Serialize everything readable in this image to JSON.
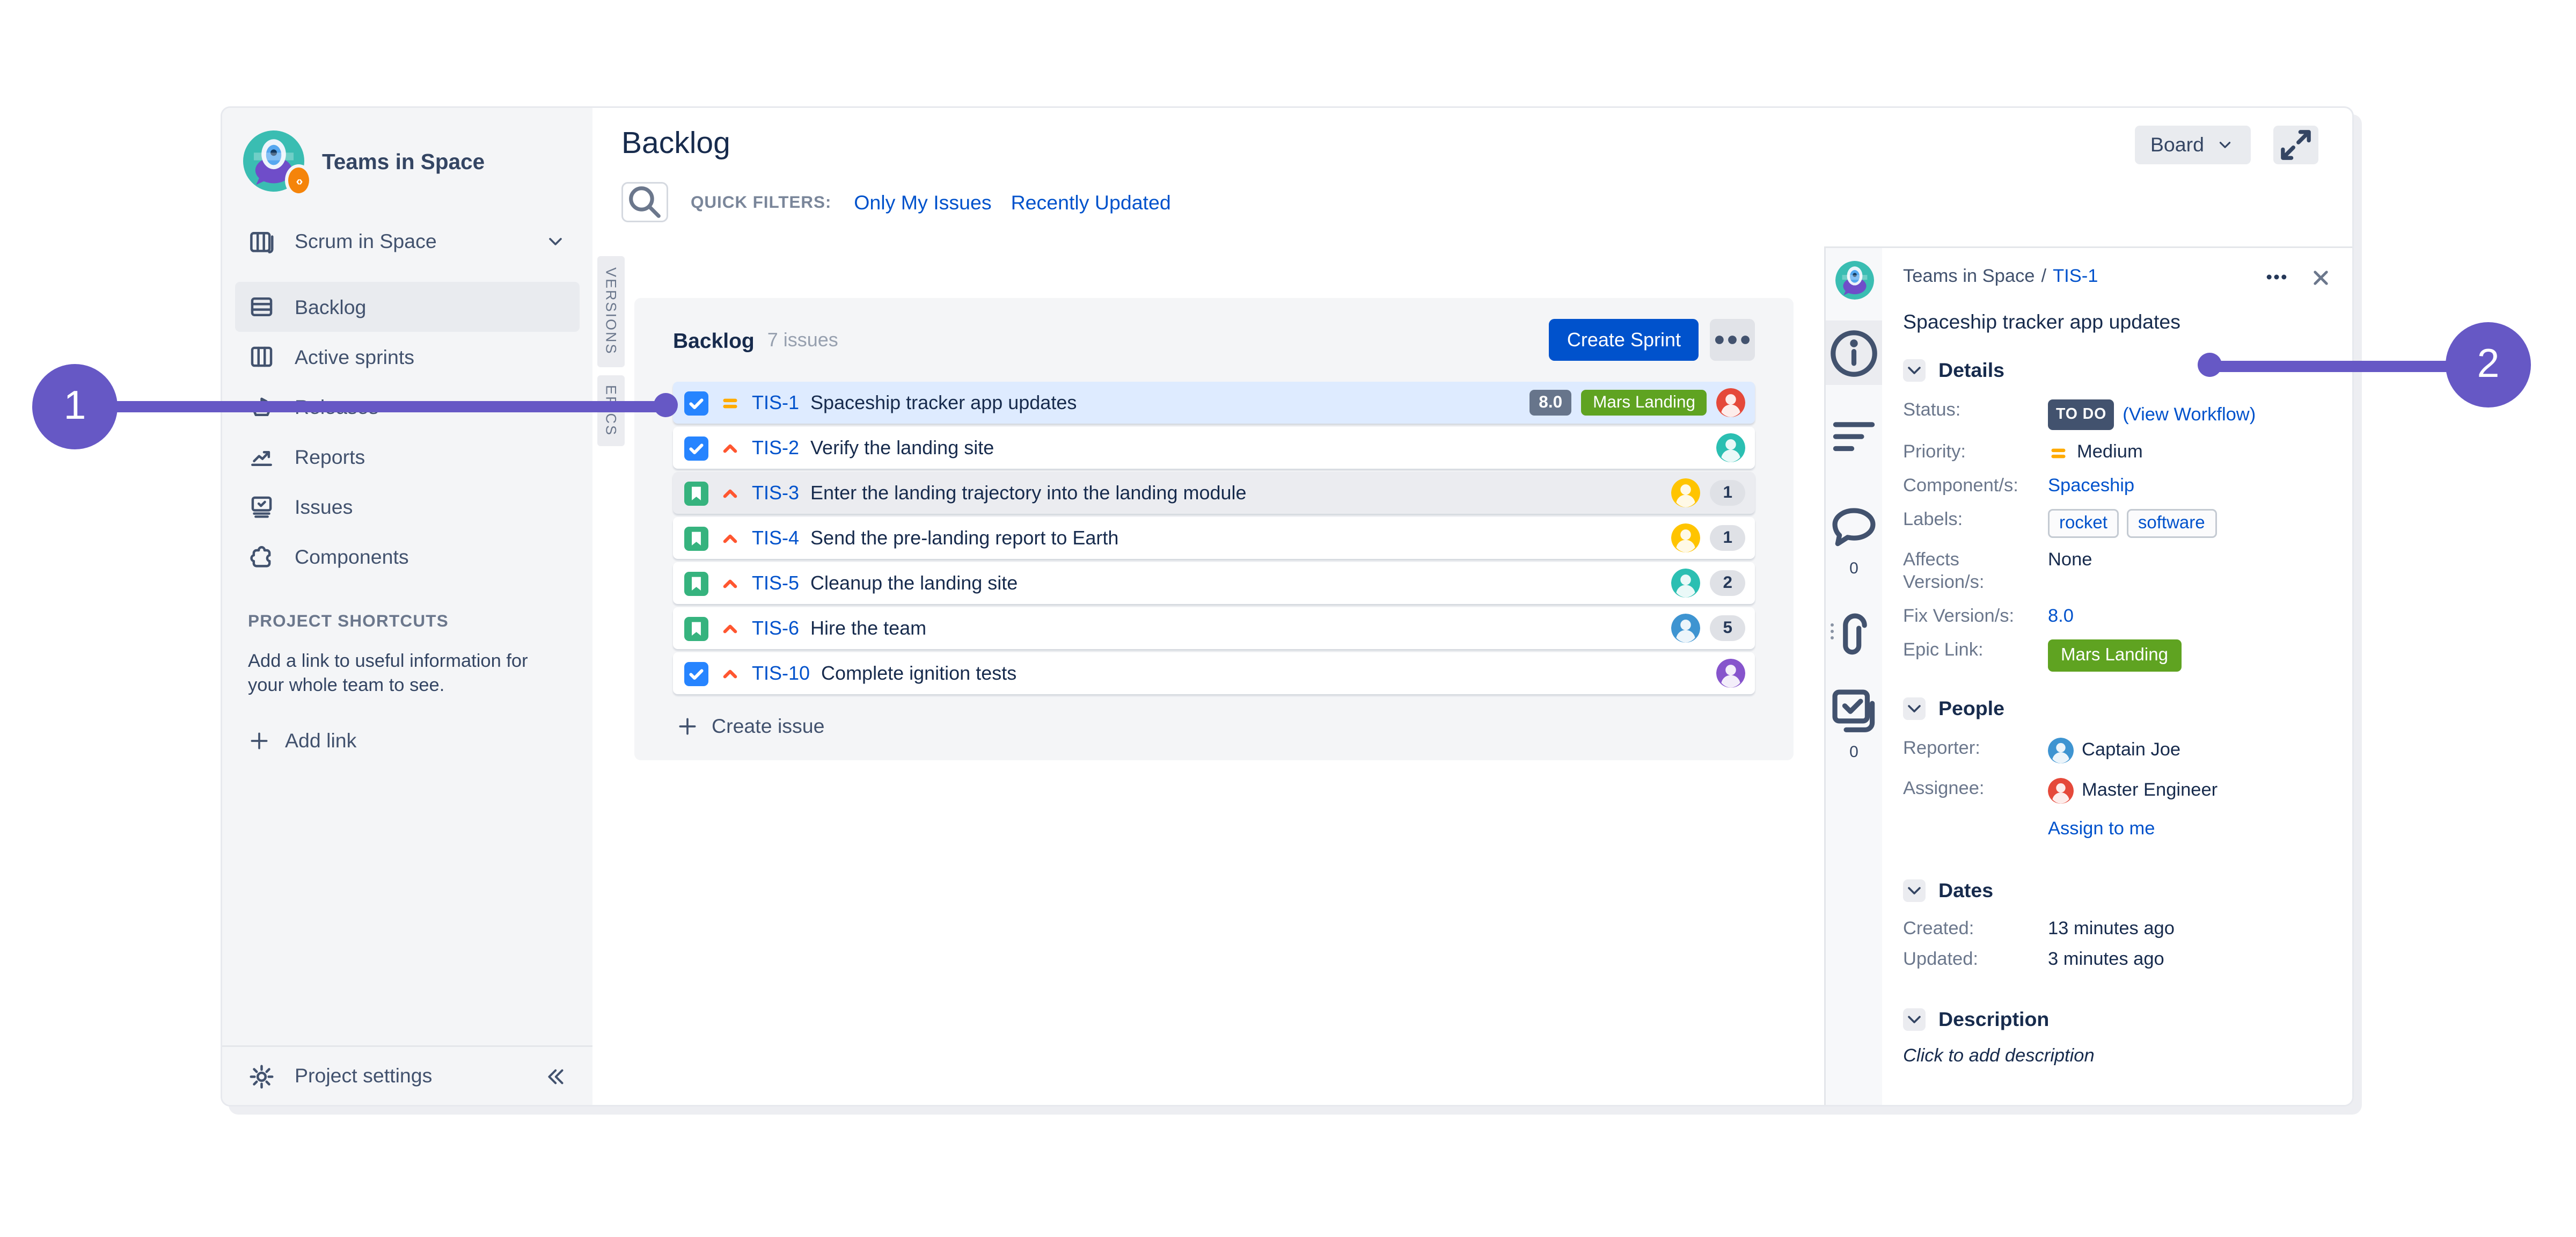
{
  "colors": {
    "accent_purple": "#6658C5",
    "link_blue": "#0052CC",
    "primary_button_blue": "#0052CC",
    "selected_row_blue": "#DEEBFF",
    "epic_green": "#5FA321",
    "status_badge_navy": "#42526E",
    "priority_medium_orange": "#FFAB00",
    "priority_high_red": "#FF5630",
    "task_icon_blue": "#2684FF",
    "story_icon_green": "#36B37E"
  },
  "annotations": {
    "one": "1",
    "two": "2"
  },
  "sidebar": {
    "project_name": "Teams in Space",
    "switcher_label": "Scrum in Space",
    "items": [
      {
        "label": "Backlog",
        "icon": "backlog",
        "active": true
      },
      {
        "label": "Active sprints",
        "icon": "sprints",
        "active": false
      },
      {
        "label": "Releases",
        "icon": "releases",
        "active": false
      },
      {
        "label": "Reports",
        "icon": "reports",
        "active": false
      },
      {
        "label": "Issues",
        "icon": "issues",
        "active": false
      },
      {
        "label": "Components",
        "icon": "components",
        "active": false
      }
    ],
    "shortcuts_title": "PROJECT SHORTCUTS",
    "shortcuts_hint": "Add a link to useful information for your whole team to see.",
    "add_link_label": "Add link",
    "settings_label": "Project settings"
  },
  "tabs": {
    "versions": "VERSIONS",
    "epics": "EPICS"
  },
  "header": {
    "title": "Backlog",
    "quick_filters_label": "QUICK FILTERS:",
    "filters": [
      "Only My Issues",
      "Recently Updated"
    ],
    "board_button_label": "Board"
  },
  "backlog": {
    "panel_title": "Backlog",
    "issue_count": "7 issues",
    "create_sprint_label": "Create Sprint",
    "create_issue_label": "Create issue",
    "rows": [
      {
        "key": "TIS-1",
        "summary": "Spaceship tracker app updates",
        "type": "task",
        "priority": "medium",
        "estimate": "8.0",
        "epic": "Mars Landing",
        "avatar": "#E5493A",
        "count": "",
        "state": "selected"
      },
      {
        "key": "TIS-2",
        "summary": "Verify the landing site",
        "type": "task",
        "priority": "high",
        "estimate": "",
        "epic": "",
        "avatar": "#2BBFB2",
        "count": "",
        "state": ""
      },
      {
        "key": "TIS-3",
        "summary": "Enter the landing trajectory into the landing module",
        "type": "story",
        "priority": "high",
        "estimate": "",
        "epic": "",
        "avatar": "#FFC400",
        "count": "1",
        "state": "hover"
      },
      {
        "key": "TIS-4",
        "summary": "Send the pre-landing report to Earth",
        "type": "story",
        "priority": "high",
        "estimate": "",
        "epic": "",
        "avatar": "#FFC400",
        "count": "1",
        "state": ""
      },
      {
        "key": "TIS-5",
        "summary": "Cleanup the landing site",
        "type": "story",
        "priority": "high",
        "estimate": "",
        "epic": "",
        "avatar": "#2BBFB2",
        "count": "2",
        "state": ""
      },
      {
        "key": "TIS-6",
        "summary": "Hire the team",
        "type": "story",
        "priority": "high",
        "estimate": "",
        "epic": "",
        "avatar": "#3E94D1",
        "count": "5",
        "state": ""
      },
      {
        "key": "TIS-10",
        "summary": "Complete ignition tests",
        "type": "task",
        "priority": "high",
        "estimate": "",
        "epic": "",
        "avatar": "#8654CC",
        "count": "",
        "state": ""
      }
    ]
  },
  "detail": {
    "breadcrumb_project": "Teams in Space",
    "breadcrumb_separator": "/",
    "breadcrumb_issue": "TIS-1",
    "title": "Spaceship tracker app updates",
    "comment_count": "0",
    "subtask_count": "0",
    "sections": {
      "details": "Details",
      "people": "People",
      "dates": "Dates",
      "description": "Description"
    },
    "fields": {
      "status_label": "Status:",
      "status_value": "TO DO",
      "status_link": "(View Workflow)",
      "priority_label": "Priority:",
      "priority_value": "Medium",
      "components_label": "Component/s:",
      "components_value": "Spaceship",
      "labels_label": "Labels:",
      "labels": [
        "rocket",
        "software"
      ],
      "affects_label": "Affects Version/s:",
      "affects_value": "None",
      "fix_label": "Fix Version/s:",
      "fix_value": "8.0",
      "epic_label": "Epic Link:",
      "epic_value": "Mars Landing"
    },
    "people": {
      "reporter_label": "Reporter:",
      "reporter_value": "Captain Joe",
      "reporter_avatar": "#3E94D1",
      "assignee_label": "Assignee:",
      "assignee_value": "Master Engineer",
      "assignee_avatar": "#E5493A",
      "assign_link": "Assign to me"
    },
    "dates": {
      "created_label": "Created:",
      "created_value": "13 minutes ago",
      "updated_label": "Updated:",
      "updated_value": "3 minutes ago"
    },
    "description_placeholder": "Click to add description"
  }
}
